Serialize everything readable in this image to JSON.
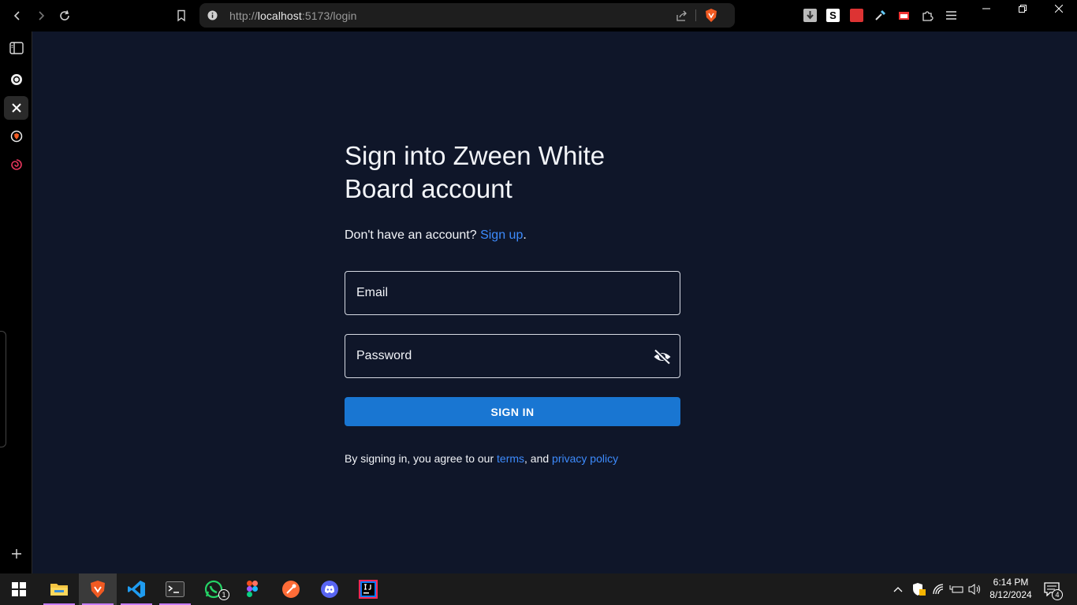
{
  "browser": {
    "url_scheme": "http://",
    "url_host": "localhost",
    "url_path": ":5173/login"
  },
  "page": {
    "title": "Sign into Zween White Board account",
    "signup_prompt": "Don't have an account?",
    "signup_link": "Sign up",
    "signup_period": ".",
    "email_label": "Email",
    "password_label": "Password",
    "signin_button": "SIGN IN",
    "terms_prefix": "By signing in, you agree to our",
    "terms_link": "terms",
    "terms_mid": ", and",
    "privacy_link": "privacy policy"
  },
  "taskbar": {
    "time": "6:14 PM",
    "date": "8/12/2024",
    "whatsapp_badge": "1",
    "notifications_badge": "4"
  },
  "colors": {
    "page_bg": "#0f1629",
    "accent": "#1976d2",
    "link": "#3d8bfd"
  }
}
